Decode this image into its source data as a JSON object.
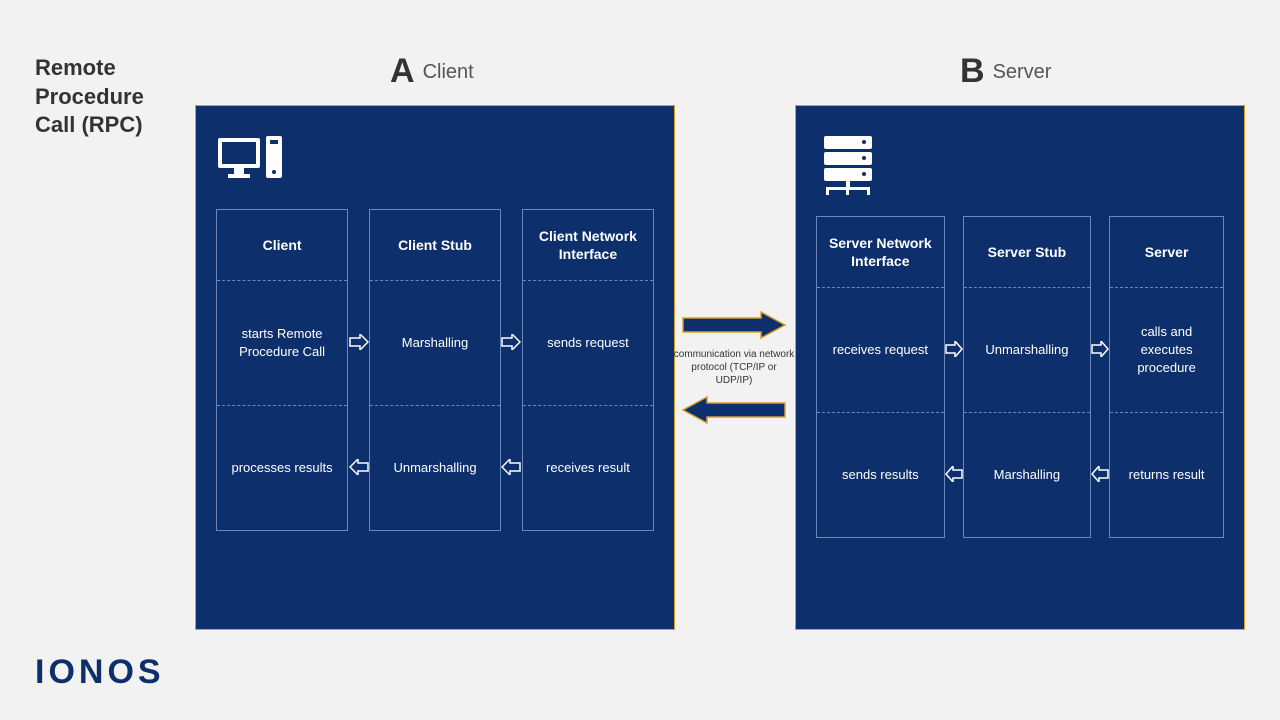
{
  "title_line1": "Remote",
  "title_line2": "Procedure",
  "title_line3": "Call (RPC)",
  "panelA": {
    "letter": "A",
    "label": "Client"
  },
  "panelB": {
    "letter": "B",
    "label": "Server"
  },
  "client": {
    "col1": {
      "header": "Client",
      "top": "starts Remote Procedure Call",
      "bot": "processes results"
    },
    "col2": {
      "header": "Client Stub",
      "top": "Marshalling",
      "bot": "Unmarshalling"
    },
    "col3": {
      "header": "Client Network Interface",
      "top": "sends request",
      "bot": "receives result"
    }
  },
  "server": {
    "col1": {
      "header": "Server Network Interface",
      "top": "receives request",
      "bot": "sends results"
    },
    "col2": {
      "header": "Server Stub",
      "top": "Unmarshalling",
      "bot": "Marshalling"
    },
    "col3": {
      "header": "Server",
      "top": "calls and executes procedure",
      "bot": "returns result"
    }
  },
  "network": {
    "text": "communication via network protocol (TCP/IP or UDP/IP)"
  },
  "logo": "IONOS"
}
